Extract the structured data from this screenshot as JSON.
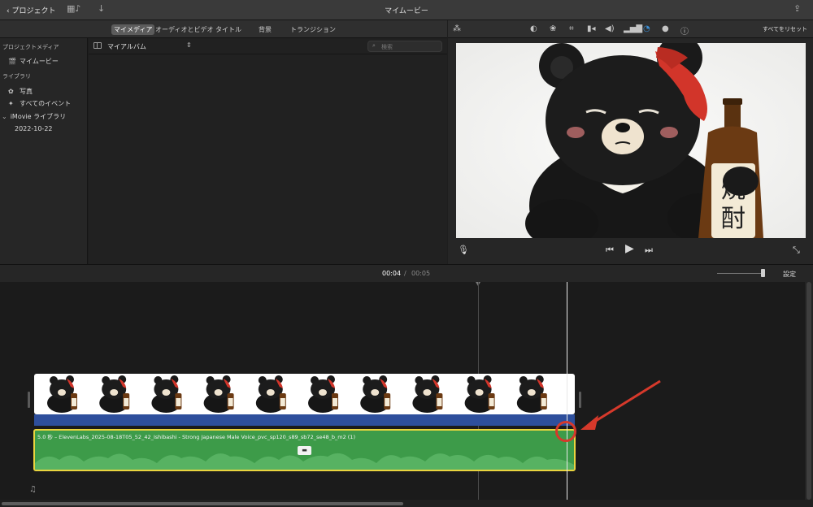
{
  "titlebar": {
    "back_label": "プロジェクト",
    "title": "マイムービー",
    "icons": [
      "media-library-icon",
      "import-icon",
      "share-icon"
    ]
  },
  "browser": {
    "tabs": [
      "マイメディア",
      "オーディオとビデオ",
      "タイトル",
      "背景",
      "トランジション"
    ],
    "active_tab": "マイメディア",
    "album": "マイアルバム",
    "search_placeholder": "検索"
  },
  "sidebar": {
    "project_media_header": "プロジェクトメディア",
    "project_item": "マイムービー",
    "library_header": "ライブラリ",
    "photos": "写真",
    "all_events": "すべてのイベント",
    "imovie_library": "iMovie ライブラリ",
    "event_date": "2022-10-22"
  },
  "viewer": {
    "toolbar_icons": [
      "magic-wand-icon",
      "color-balance-icon",
      "color-correction-icon",
      "crop-icon",
      "stabilization-icon",
      "volume-icon",
      "noise-reduction-icon",
      "speed-icon",
      "filter-icon",
      "info-icon"
    ],
    "reset_all": "すべてをリセット",
    "bottle_text": "焼酎",
    "accent_color": "#3a8fd6"
  },
  "timeline": {
    "current_time": "00:04",
    "separator": "/",
    "total_time": "00:05",
    "settings": "設定",
    "audio_clip_label": "5.0 秒 – ElevenLabs_2025-08-18T05_52_42_Ishibashi - Strong Japanese Male Voice_pvc_sp120_s89_sb72_se48_b_m2 (1)",
    "audio_color": "#3d9b49",
    "selection_color": "#e9d43f",
    "annotation_color": "#d6392b"
  }
}
